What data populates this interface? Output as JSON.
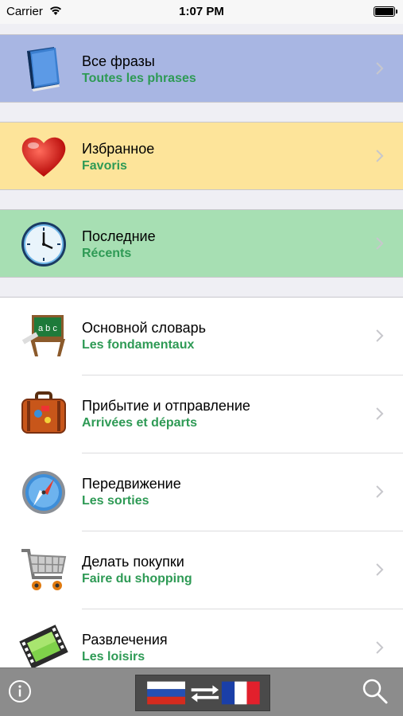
{
  "status_bar": {
    "carrier": "Carrier",
    "time": "1:07 PM"
  },
  "special_rows": [
    {
      "title": "Все фразы",
      "subtitle": "Toutes les phrases",
      "icon": "book-icon",
      "bg": "#a8b6e3"
    },
    {
      "title": "Избранное",
      "subtitle": "Favoris",
      "icon": "heart-icon",
      "bg": "#fde49a"
    },
    {
      "title": "Последние",
      "subtitle": "Récents",
      "icon": "clock-icon",
      "bg": "#a7dfb3"
    }
  ],
  "categories": [
    {
      "title": "Основной словарь",
      "subtitle": "Les fondamentaux",
      "icon": "chalkboard-icon"
    },
    {
      "title": "Прибытие и отправление",
      "subtitle": "Arrivées et départs",
      "icon": "suitcase-icon"
    },
    {
      "title": "Передвижение",
      "subtitle": "Les sorties",
      "icon": "compass-icon"
    },
    {
      "title": "Делать покупки",
      "subtitle": "Faire du shopping",
      "icon": "shopping-cart-icon"
    },
    {
      "title": "Развлечения",
      "subtitle": "Les loisirs",
      "icon": "film-icon"
    }
  ],
  "toolbar": {
    "info": "info-icon",
    "language_switch": "language-swap-icon",
    "search": "search-icon"
  },
  "colors": {
    "subtitle_green": "#2e9a55",
    "toolbar_gray": "#8c8c8c"
  }
}
